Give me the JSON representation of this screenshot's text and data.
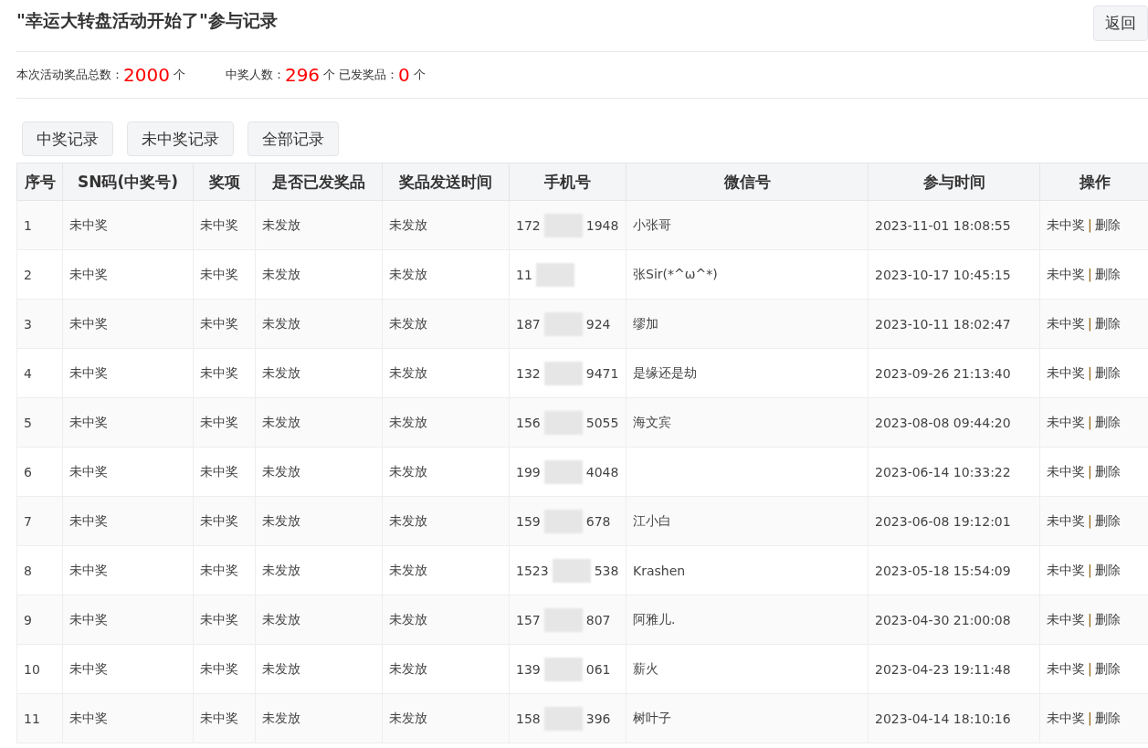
{
  "title": "\"幸运大转盘活动开始了\"参与记录",
  "back_button": "返回",
  "stats": [
    {
      "label": "本次活动奖品总数：",
      "value": "2000",
      "unit": "个"
    },
    {
      "label": "中奖人数：",
      "value": "296",
      "unit": "个"
    },
    {
      "label": "已发奖品：",
      "value": "0",
      "unit": "个"
    }
  ],
  "filter_buttons": [
    "中奖记录",
    "未中奖记录",
    "全部记录"
  ],
  "table": {
    "columns": [
      "序号",
      "SN码(中奖号)",
      "奖项",
      "是否已发奖品",
      "奖品发送时间",
      "手机号",
      "微信号",
      "参与时间",
      "操作"
    ],
    "rows": [
      {
        "index": "1",
        "sn": "未中奖",
        "prize": "未中奖",
        "sent": "未发放",
        "send_time": "未发放",
        "phone_prefix": "172",
        "phone_suffix": "1948",
        "wechat": "小张哥",
        "time": "2023-11-01 18:08:55",
        "actions": [
          "未中奖",
          "删除"
        ],
        "separator": "|"
      },
      {
        "index": "2",
        "sn": "未中奖",
        "prize": "未中奖",
        "sent": "未发放",
        "send_time": "未发放",
        "phone_prefix": "11",
        "wechat": "张Sir(*^ω^*)",
        "time": "2023-10-17 10:45:15",
        "actions": [
          "未中奖",
          "删除"
        ],
        "separator": "|"
      },
      {
        "index": "3",
        "sn": "未中奖",
        "prize": "未中奖",
        "sent": "未发放",
        "send_time": "未发放",
        "phone_prefix": "187",
        "phone_suffix": "924",
        "wechat": "缪加",
        "time": "2023-10-11 18:02:47",
        "actions": [
          "未中奖",
          "删除"
        ],
        "separator": "|"
      },
      {
        "index": "4",
        "sn": "未中奖",
        "prize": "未中奖",
        "sent": "未发放",
        "send_time": "未发放",
        "phone_prefix": "132",
        "phone_suffix": "9471",
        "wechat": "是缘还是劫",
        "time": "2023-09-26 21:13:40",
        "actions": [
          "未中奖",
          "删除"
        ],
        "separator": "|"
      },
      {
        "index": "5",
        "sn": "未中奖",
        "prize": "未中奖",
        "sent": "未发放",
        "send_time": "未发放",
        "phone_prefix": "156",
        "phone_suffix": "5055",
        "wechat": "海文宾",
        "time": "2023-08-08 09:44:20",
        "actions": [
          "未中奖",
          "删除"
        ],
        "separator": "|"
      },
      {
        "index": "6",
        "sn": "未中奖",
        "prize": "未中奖",
        "sent": "未发放",
        "send_time": "未发放",
        "phone_prefix": "199",
        "phone_suffix": "4048",
        "time": "2023-06-14 10:33:22",
        "actions": [
          "未中奖",
          "删除"
        ],
        "separator": "|"
      },
      {
        "index": "7",
        "sn": "未中奖",
        "prize": "未中奖",
        "sent": "未发放",
        "send_time": "未发放",
        "phone_prefix": "159",
        "phone_suffix": "678",
        "wechat": "江小白",
        "time": "2023-06-08 19:12:01",
        "actions": [
          "未中奖",
          "删除"
        ],
        "separator": "|"
      },
      {
        "index": "8",
        "sn": "未中奖",
        "prize": "未中奖",
        "sent": "未发放",
        "send_time": "未发放",
        "phone_prefix": "1523",
        "phone_suffix": "538",
        "wechat": "Krashen",
        "time": "2023-05-18 15:54:09",
        "actions": [
          "未中奖",
          "删除"
        ],
        "separator": "|"
      },
      {
        "index": "9",
        "sn": "未中奖",
        "prize": "未中奖",
        "sent": "未发放",
        "send_time": "未发放",
        "phone_prefix": "157",
        "phone_suffix": "807",
        "wechat": "阿雅儿.",
        "time": "2023-04-30 21:00:08",
        "actions": [
          "未中奖",
          "删除"
        ],
        "separator": "|"
      },
      {
        "index": "10",
        "sn": "未中奖",
        "prize": "未中奖",
        "sent": "未发放",
        "send_time": "未发放",
        "phone_prefix": "139",
        "phone_suffix": "061",
        "wechat": "薪火",
        "time": "2023-04-23 19:11:48",
        "actions": [
          "未中奖",
          "删除"
        ],
        "separator": "|"
      },
      {
        "index": "11",
        "sn": "未中奖",
        "prize": "未中奖",
        "sent": "未发放",
        "send_time": "未发放",
        "phone_prefix": "158",
        "phone_suffix": "396",
        "wechat": "树叶子",
        "time": "2023-04-14 18:10:16",
        "actions": [
          "未中奖",
          "删除"
        ],
        "separator": "|"
      }
    ]
  }
}
